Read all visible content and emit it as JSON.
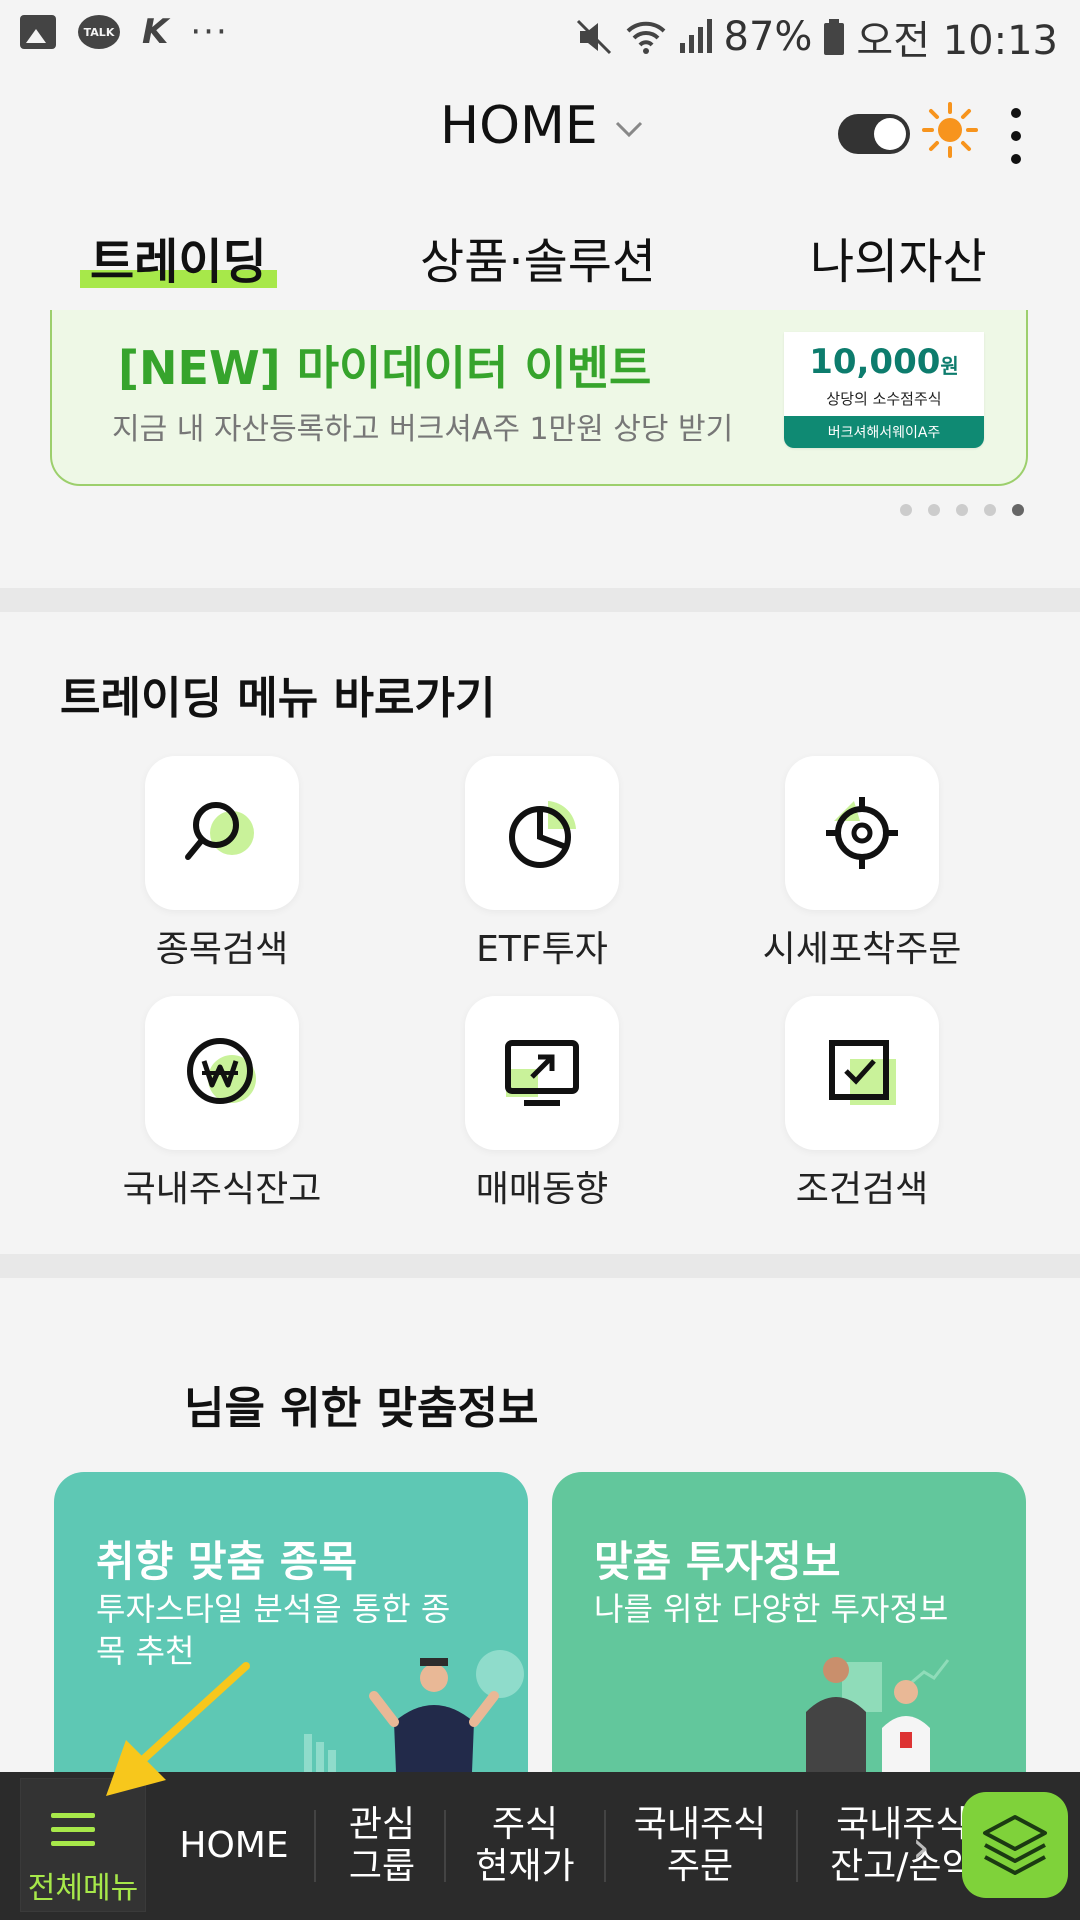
{
  "status_bar": {
    "battery": "87%",
    "time": "오전 10:13",
    "left_icons": [
      "gallery-icon",
      "kakaotalk-icon",
      "k-app-icon",
      "more-notifications-icon"
    ],
    "talk_label": "TALK",
    "k_glyph": "K",
    "dots": "···"
  },
  "header": {
    "title": "HOME",
    "chevron": "⌄",
    "theme_toggle_on": true
  },
  "tabs": [
    {
      "label": "트레이딩",
      "active": true
    },
    {
      "label": "상품·솔루션",
      "active": false
    },
    {
      "label": "나의자산",
      "active": false
    }
  ],
  "banner": {
    "title": "[NEW] 마이데이터 이벤트",
    "subtitle": "지금 내 자산등록하고 버크셔A주 1만원 상당 받기",
    "coupon_amount": "10,000",
    "coupon_unit": "원",
    "coupon_desc": "상당의 소수점주식",
    "coupon_foot": "버크셔해서웨이A주",
    "page_index": 5,
    "page_count": 5
  },
  "quick_menu": {
    "title": "트레이딩 메뉴 바로가기",
    "items": [
      {
        "label": "종목검색",
        "icon": "search-icon"
      },
      {
        "label": "ETF투자",
        "icon": "pie-chart-icon"
      },
      {
        "label": "시세포착주문",
        "icon": "target-icon"
      },
      {
        "label": "국내주식잔고",
        "icon": "won-coin-icon"
      },
      {
        "label": "매매동향",
        "icon": "monitor-trend-icon"
      },
      {
        "label": "조건검색",
        "icon": "checkbox-icon"
      }
    ]
  },
  "recommend": {
    "title": "님을 위한 맞춤정보",
    "cards": [
      {
        "title": "취향 맞춤 종목",
        "subtitle": "투자스타일 분석을 통한 종목 추천",
        "color": "#5ec8b4"
      },
      {
        "title": "맞춤 투자정보",
        "subtitle": "나를 위한 다양한 투자정보",
        "color": "#62c79c"
      }
    ]
  },
  "bottom_nav": {
    "menu_label": "전체메뉴",
    "items": [
      "HOME",
      "관심\n그룹",
      "주식\n현재가",
      "국내주식\n주문",
      "국내주식\n잔고/손익"
    ],
    "accent": "#a7e84a"
  }
}
